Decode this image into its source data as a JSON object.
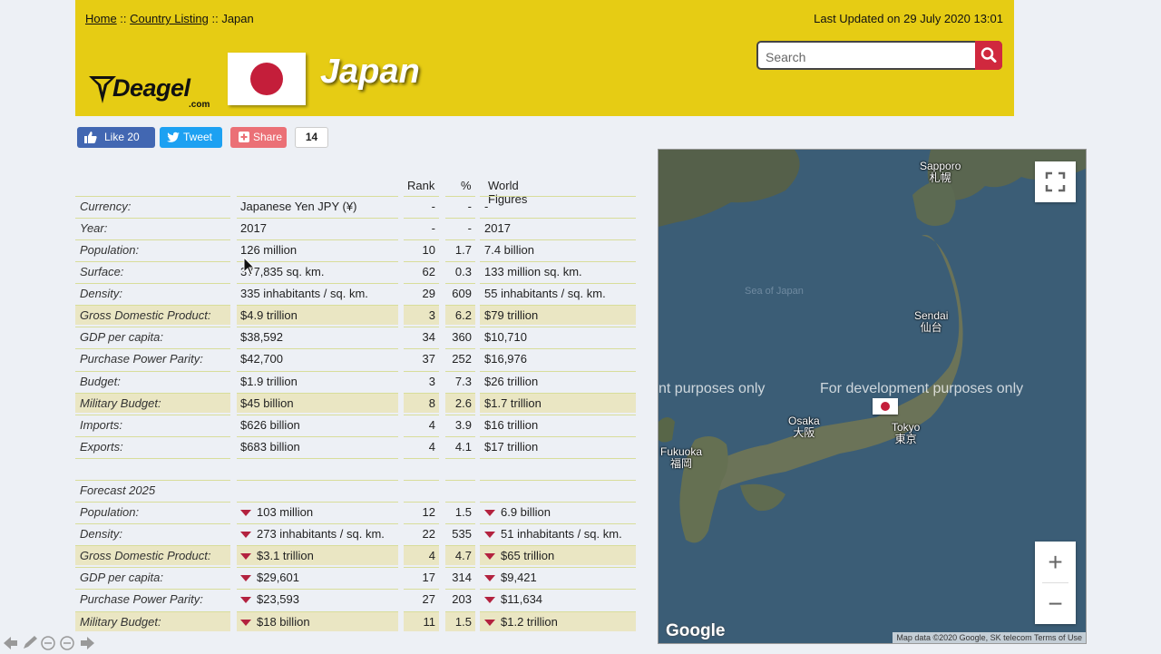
{
  "breadcrumb": {
    "home": "Home",
    "sep1": " :: ",
    "listing": "Country Listing",
    "sep2": " :: ",
    "current": "Japan"
  },
  "last_updated": "Last Updated on 29 July 2020 13:01",
  "search": {
    "placeholder": "Search"
  },
  "logo": {
    "text": "Deagel",
    "sub": ".com"
  },
  "country": "Japan",
  "social": {
    "like": "Like 20",
    "tweet": "Tweet",
    "share": "Share",
    "count": "14"
  },
  "table": {
    "headers": {
      "rank": "Rank",
      "pct": "%",
      "world": "World Figures"
    },
    "rows": [
      {
        "label": "Currency:",
        "value": "Japanese Yen JPY (¥)",
        "rank": "-",
        "pct": "-",
        "world": "-"
      },
      {
        "label": "Year:",
        "value": "2017",
        "rank": "-",
        "pct": "-",
        "world": "2017"
      },
      {
        "label": "Population:",
        "value": "126 million",
        "rank": "10",
        "pct": "1.7",
        "world": "7.4 billion"
      },
      {
        "label": "Surface:",
        "value": "377,835 sq. km.",
        "rank": "62",
        "pct": "0.3",
        "world": "133 million sq. km."
      },
      {
        "label": "Density:",
        "value": "335 inhabitants / sq. km.",
        "rank": "29",
        "pct": "609",
        "world": "55 inhabitants / sq. km."
      },
      {
        "label": "Gross Domestic Product:",
        "value": "$4.9 trillion",
        "rank": "3",
        "pct": "6.2",
        "world": "$79 trillion"
      },
      {
        "label": "GDP per capita:",
        "value": "$38,592",
        "rank": "34",
        "pct": "360",
        "world": "$10,710"
      },
      {
        "label": "Purchase Power Parity:",
        "value": "$42,700",
        "rank": "37",
        "pct": "252",
        "world": "$16,976"
      },
      {
        "label": "Budget:",
        "value": "$1.9 trillion",
        "rank": "3",
        "pct": "7.3",
        "world": "$26 trillion"
      },
      {
        "label": "Military Budget:",
        "value": "$45 billion",
        "rank": "8",
        "pct": "2.6",
        "world": "$1.7 trillion"
      },
      {
        "label": "Imports:",
        "value": "$626 billion",
        "rank": "4",
        "pct": "3.9",
        "world": "$16 trillion"
      },
      {
        "label": "Exports:",
        "value": "$683 billion",
        "rank": "4",
        "pct": "4.1",
        "world": "$17 trillion"
      }
    ],
    "forecast_title": "Forecast 2025",
    "forecast_rows": [
      {
        "label": "Population:",
        "value": "103 million",
        "rank": "12",
        "pct": "1.5",
        "world": "6.9 billion"
      },
      {
        "label": "Density:",
        "value": "273 inhabitants / sq. km.",
        "rank": "22",
        "pct": "535",
        "world": "51 inhabitants / sq. km."
      },
      {
        "label": "Gross Domestic Product:",
        "value": "$3.1 trillion",
        "rank": "4",
        "pct": "4.7",
        "world": "$65 trillion"
      },
      {
        "label": "GDP per capita:",
        "value": "$29,601",
        "rank": "17",
        "pct": "314",
        "world": "$9,421"
      },
      {
        "label": "Purchase Power Parity:",
        "value": "$23,593",
        "rank": "27",
        "pct": "203",
        "world": "$11,634"
      },
      {
        "label": "Military Budget:",
        "value": "$18 billion",
        "rank": "11",
        "pct": "1.5",
        "world": "$1.2 trillion"
      }
    ]
  },
  "map": {
    "cities": {
      "sapporo": "Sapporo",
      "sapporo_jp": "札幌",
      "sendai": "Sendai",
      "sendai_jp": "仙台",
      "osaka": "Osaka",
      "osaka_jp": "大阪",
      "tokyo": "Tokyo",
      "tokyo_jp": "東京",
      "fukuoka": "Fukuoka",
      "fukuoka_jp": "福岡"
    },
    "sea": "Sea of Japan",
    "watermark_left": "nt purposes only",
    "watermark_right": "For development purposes only",
    "attribution": "Map data ©2020 Google, SK telecom    Terms of Use",
    "google": "Google",
    "zoom_in": "+",
    "zoom_out": "−"
  },
  "colors": {
    "header": "#e6cc14",
    "accent_red": "#c41e3a",
    "facebook": "#4267b2",
    "twitter": "#1da1f2",
    "share": "#eb7076"
  }
}
